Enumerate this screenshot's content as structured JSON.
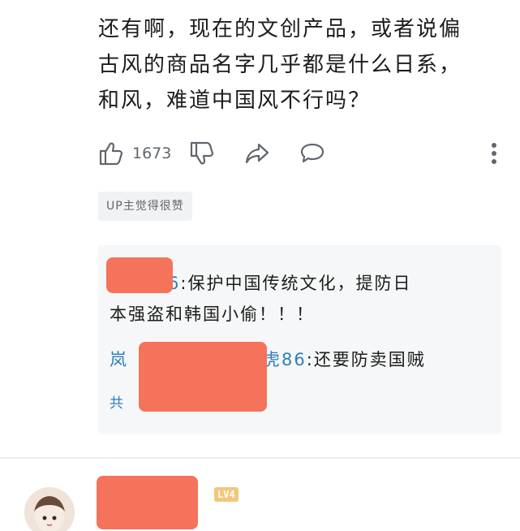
{
  "comment": {
    "text": "还有啊，现在的文创产品，或者说偏\n古风的商品名字几乎都是什么日系，\n和风，难道中国风不行吗？"
  },
  "actions": {
    "like_count": "1673"
  },
  "badge": {
    "up_liked": "UP主觉得很赞"
  },
  "replies": [
    {
      "user_suffix": "6",
      "separator": ":",
      "text_line1": "保护中国传统文化，提防日",
      "text_line2": "本强盗和韩国小偷！！！"
    },
    {
      "user_prefix": "岚",
      "user_suffix": "虎86",
      "separator": ":",
      "text": "还要防卖国贼"
    }
  ],
  "more_replies": {
    "label_prefix": "共"
  },
  "next_comment": {
    "level": "LV4"
  },
  "colors": {
    "username_blue": "#2a7fbf",
    "redaction": "#f4735a",
    "reply_bg": "#f6f7f8",
    "level_badge": "#f3c77a"
  }
}
